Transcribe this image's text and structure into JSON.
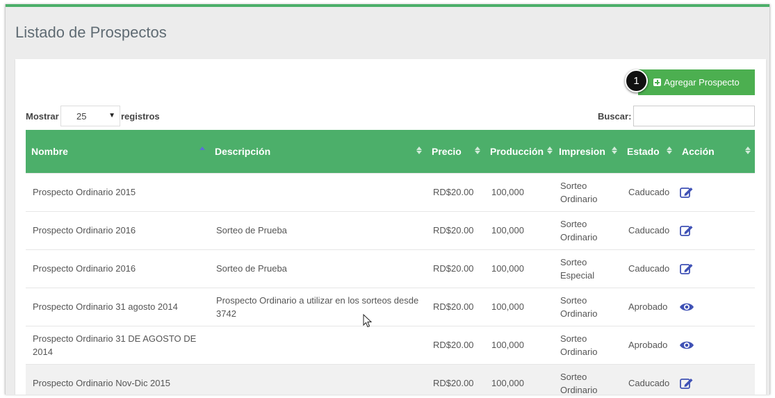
{
  "page": {
    "title": "Listado de Prospectos"
  },
  "toolbar": {
    "add_label": "Agregar Prospecto",
    "step_badge": "1"
  },
  "controls": {
    "show_label": "Mostrar",
    "page_size": "25",
    "records_label": "registros",
    "search_label": "Buscar:",
    "search_value": ""
  },
  "table": {
    "columns": [
      {
        "label": "Nombre"
      },
      {
        "label": "Descripción"
      },
      {
        "label": "Precio"
      },
      {
        "label": "Producción"
      },
      {
        "label": "Impresion"
      },
      {
        "label": "Estado"
      },
      {
        "label": "Acción"
      }
    ],
    "rows": [
      {
        "nombre": "Prospecto Ordinario 2015",
        "descripcion": "",
        "precio": "RD$20.00",
        "produccion": "100,000",
        "impresion": "Sorteo Ordinario",
        "estado": "Caducado",
        "accion": "edit-icon"
      },
      {
        "nombre": "Prospecto Ordinario 2016",
        "descripcion": "Sorteo de Prueba",
        "precio": "RD$20.00",
        "produccion": "100,000",
        "impresion": "Sorteo Ordinario",
        "estado": "Caducado",
        "accion": "edit-icon"
      },
      {
        "nombre": "Prospecto Ordinario 2016",
        "descripcion": "Sorteo de Prueba",
        "precio": "RD$20.00",
        "produccion": "100,000",
        "impresion": "Sorteo Especial",
        "estado": "Caducado",
        "accion": "edit-icon"
      },
      {
        "nombre": "Prospecto Ordinario 31 agosto 2014",
        "descripcion": "Prospecto Ordinario a utilizar en los sorteos desde 3742",
        "precio": "RD$20.00",
        "produccion": "100,000",
        "impresion": "Sorteo Ordinario",
        "estado": "Aprobado",
        "accion": "eye-icon"
      },
      {
        "nombre": "Prospecto Ordinario 31 DE AGOSTO DE 2014",
        "descripcion": "",
        "precio": "RD$20.00",
        "produccion": "100,000",
        "impresion": "Sorteo Ordinario",
        "estado": "Aprobado",
        "accion": "eye-icon"
      },
      {
        "nombre": "Prospecto Ordinario Nov-Dic 2015",
        "descripcion": "",
        "precio": "RD$20.00",
        "produccion": "100,000",
        "impresion": "Sorteo Ordinario",
        "estado": "Caducado",
        "accion": "edit-icon"
      }
    ]
  },
  "colors": {
    "accent": "#4caf6a",
    "button": "#4caf50",
    "icon": "#3f51b5"
  }
}
